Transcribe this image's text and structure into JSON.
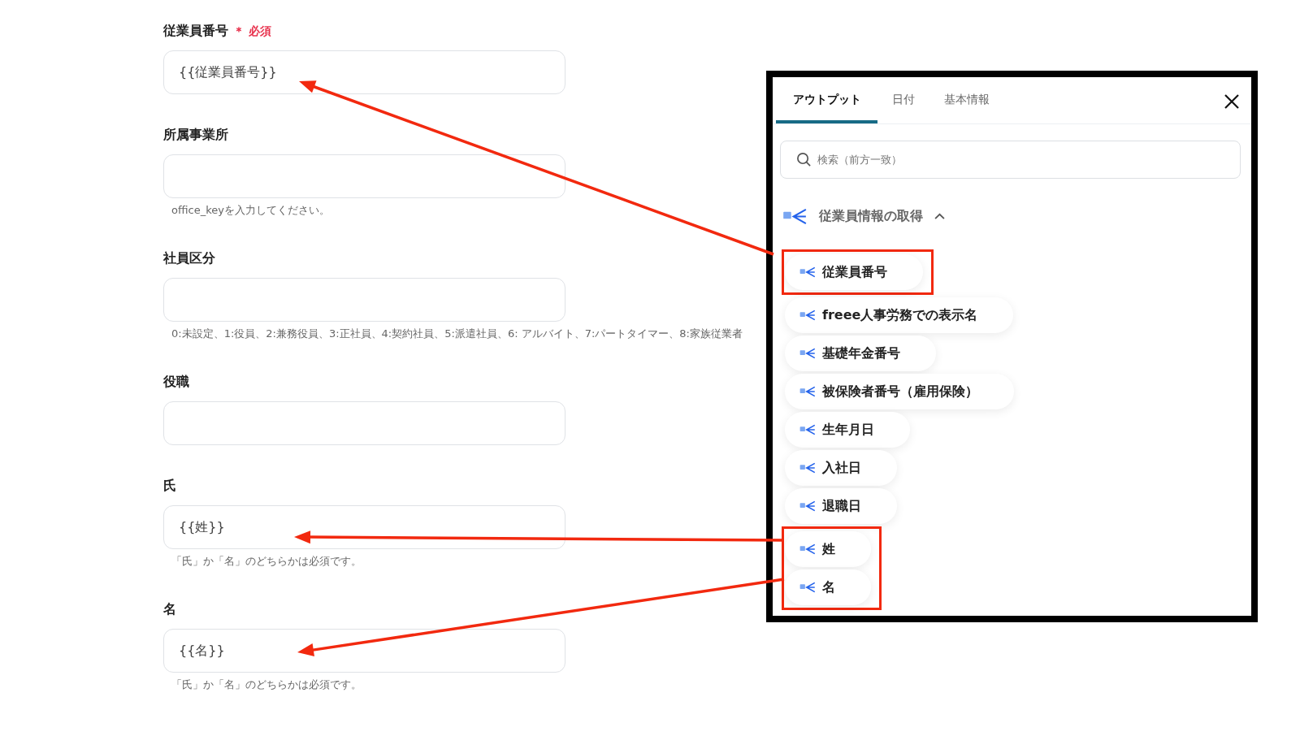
{
  "form": {
    "fields": [
      {
        "label": "従業員番号",
        "required_text": "＊ 必須",
        "value": "{{従業員番号}}"
      },
      {
        "label": "所属事業所",
        "hint": "office_keyを入力してください。"
      },
      {
        "label": "社員区分",
        "hint": "0:未設定、1:役員、2:兼務役員、3:正社員、4:契約社員、5:派遣社員、6: アルバイト、7:パートタイマー、8:家族従業者"
      },
      {
        "label": "役職"
      },
      {
        "label": "氏",
        "value": "{{姓}}",
        "hint": "「氏」か「名」のどちらかは必須です。"
      },
      {
        "label": "名",
        "value": "{{名}}",
        "hint": "「氏」か「名」のどちらかは必須です。"
      }
    ]
  },
  "output_panel": {
    "tabs": [
      {
        "label": "アウトプット",
        "selected": true
      },
      {
        "label": "日付",
        "selected": false
      },
      {
        "label": "基本情報",
        "selected": false
      }
    ],
    "search": {
      "placeholder": "検索（前方一致）"
    },
    "group": {
      "title": "従業員情報の取得",
      "expanded": true
    },
    "items": [
      {
        "label": "従業員番号",
        "highlighted": true
      },
      {
        "label": "freee人事労務での表示名",
        "highlighted": false
      },
      {
        "label": "基礎年金番号",
        "highlighted": false
      },
      {
        "label": "被保険者番号（雇用保険）",
        "highlighted": false
      },
      {
        "label": "生年月日",
        "highlighted": false
      },
      {
        "label": "入社日",
        "highlighted": false
      },
      {
        "label": "退職日",
        "highlighted": false
      },
      {
        "label": "姓",
        "highlighted": true
      },
      {
        "label": "名",
        "highlighted": true
      }
    ]
  }
}
